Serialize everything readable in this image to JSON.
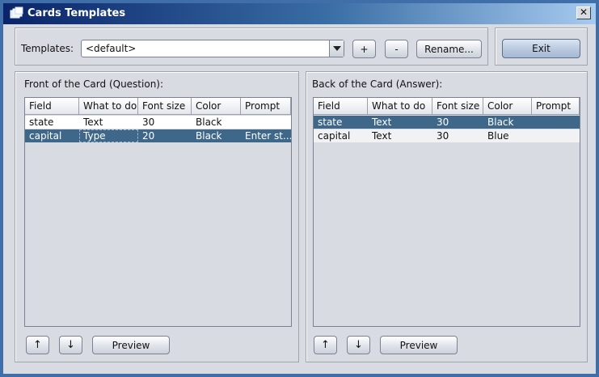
{
  "window": {
    "title": "Cards Templates",
    "close": "✕"
  },
  "toolbar": {
    "templates_label": "Templates:",
    "templates_value": "<default>",
    "add": "+",
    "remove": "-",
    "rename": "Rename...",
    "exit": "Exit"
  },
  "front": {
    "title": "Front of the Card (Question):",
    "columns": [
      "Field",
      "What to do",
      "Font size",
      "Color",
      "Prompt"
    ],
    "rows": [
      [
        "state",
        "Text",
        "30",
        "Black",
        ""
      ],
      [
        "capital",
        "Type",
        "20",
        "Black",
        "Enter st..."
      ]
    ],
    "up": "↑",
    "down": "↓",
    "preview": "Preview"
  },
  "back": {
    "title": "Back of the Card (Answer):",
    "columns": [
      "Field",
      "What to do",
      "Font size",
      "Color",
      "Prompt"
    ],
    "rows": [
      [
        "state",
        "Text",
        "30",
        "Black",
        ""
      ],
      [
        "capital",
        "Text",
        "30",
        "Blue",
        ""
      ]
    ],
    "up": "↑",
    "down": "↓",
    "preview": "Preview"
  }
}
